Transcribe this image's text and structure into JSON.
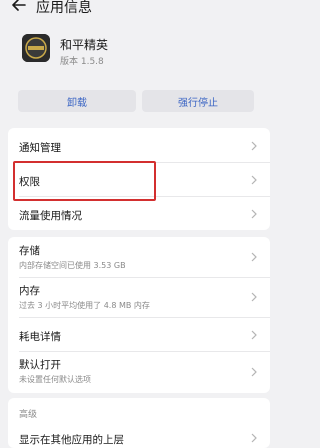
{
  "header": {
    "title": "应用信息",
    "back_icon": "arrow-left-icon"
  },
  "app": {
    "name": "和平精英",
    "version": "版本 1.5.8",
    "icon": "app-icon"
  },
  "actions": {
    "uninstall": "卸载",
    "force_stop": "强行停止",
    "accent": "#3b65c4"
  },
  "group1": [
    {
      "label": "通知管理"
    },
    {
      "label": "权限"
    },
    {
      "label": "流量使用情况"
    }
  ],
  "group2": [
    {
      "label": "存储",
      "sub": "内部存储空间已使用 3.53 GB"
    },
    {
      "label": "内存",
      "sub": "过去 3 小时平均使用了 4.8 MB 内存"
    },
    {
      "label": "耗电详情"
    },
    {
      "label": "默认打开",
      "sub": "未设置任何默认选项"
    }
  ],
  "advanced": {
    "section_label": "高级",
    "items": [
      {
        "label": "显示在其他应用的上层"
      }
    ]
  },
  "highlight_color": "#d32f2f"
}
